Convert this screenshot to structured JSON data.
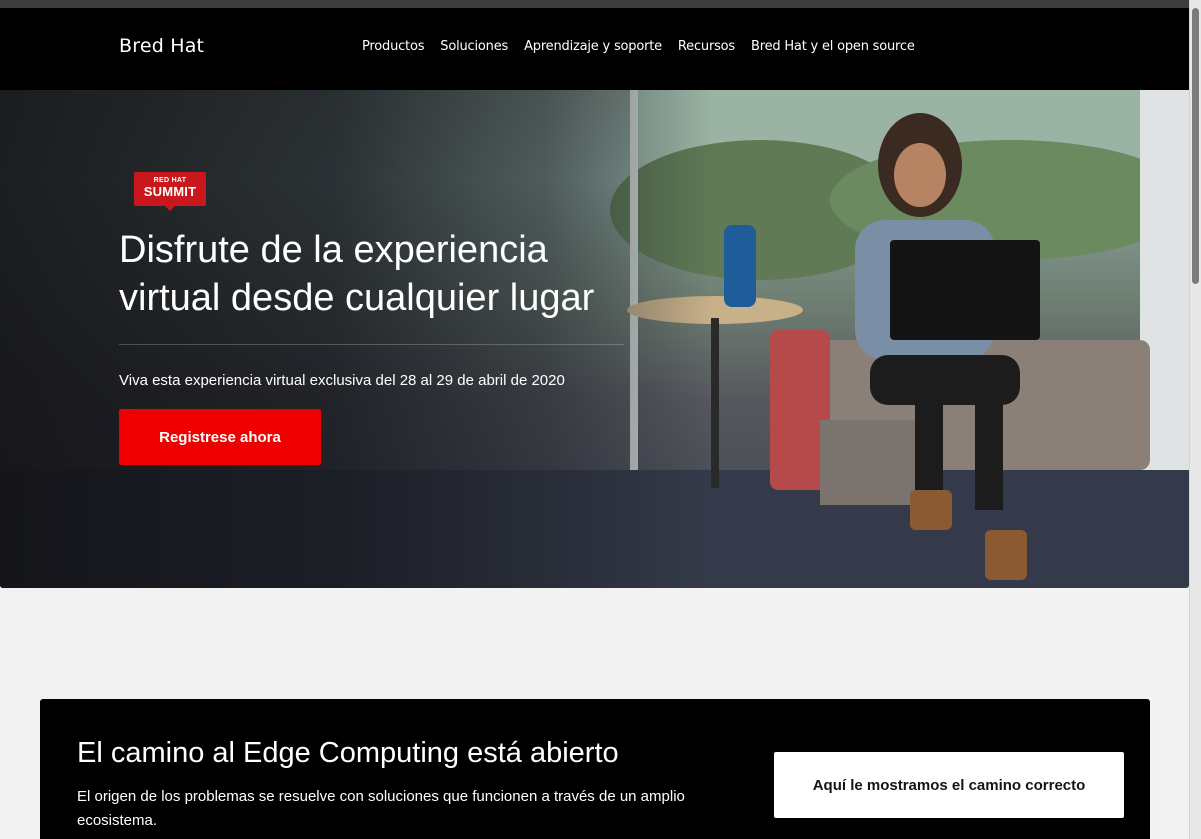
{
  "header": {
    "logo": "Bred Hat",
    "nav": [
      "Productos",
      "Soluciones",
      "Aprendizaje y soporte",
      "Recursos",
      "Bred Hat y el open source"
    ]
  },
  "hero": {
    "badge_top": "RED HAT",
    "badge_main": "SUMMIT",
    "title_line1": "Disfrute de la experiencia",
    "title_line2": "virtual desde cualquier lugar",
    "subtitle": "Viva esta experiencia virtual exclusiva del 28 al 29 de abril de 2020",
    "cta_label": "Registrese ahora"
  },
  "edge": {
    "title": "El camino al Edge Computing está abierto",
    "description": "El origen de los problemas se resuelve con soluciones que funcionen a través de un amplio ecosistema.",
    "button_label": "Aquí le mostramos el camino correcto"
  },
  "colors": {
    "accent": "#ee0000",
    "header_bg": "#000000",
    "page_bg": "#f2f2f2",
    "badge": "#c9181d"
  }
}
